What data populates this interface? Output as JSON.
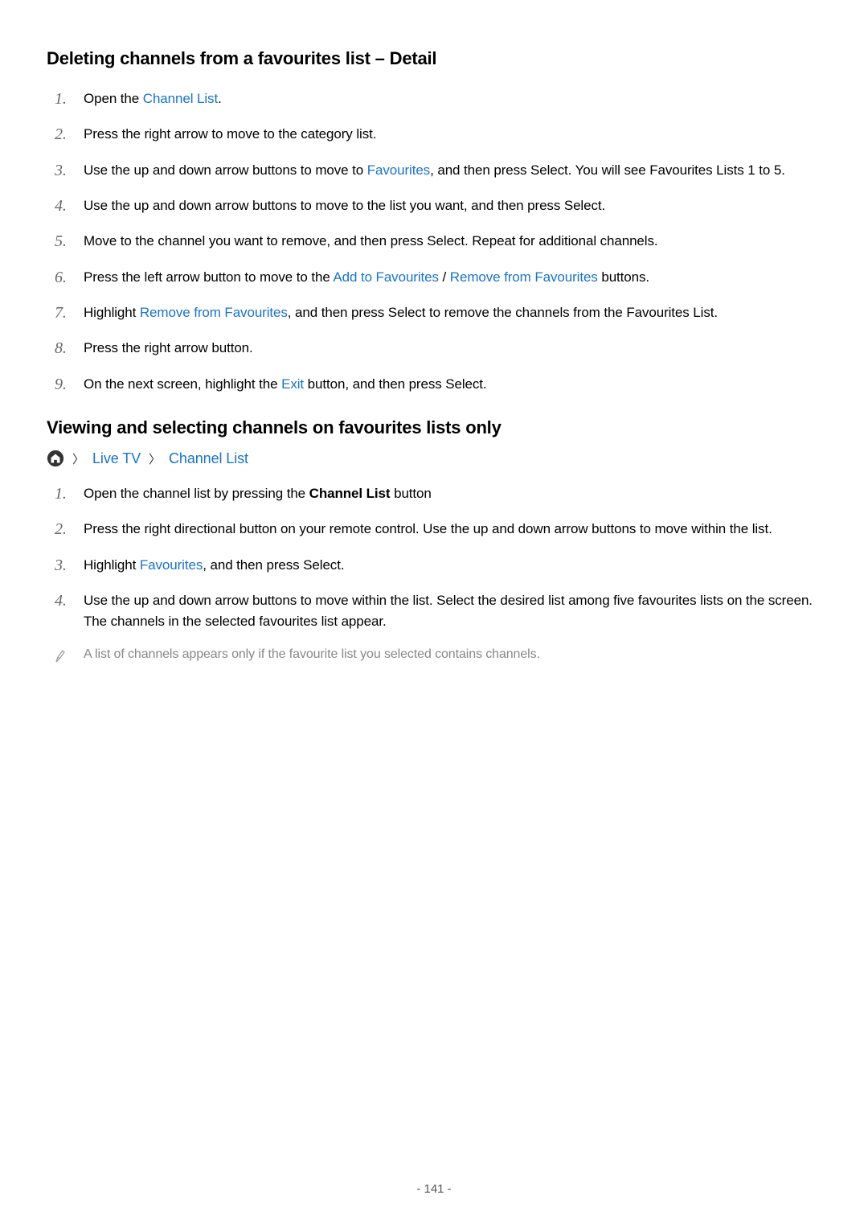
{
  "section1": {
    "heading": "Deleting channels from a favourites list – Detail",
    "steps": [
      {
        "parts": [
          {
            "text": "Open the "
          },
          {
            "text": "Channel List",
            "link": true
          },
          {
            "text": "."
          }
        ]
      },
      {
        "parts": [
          {
            "text": "Press the right arrow to move to the category list."
          }
        ]
      },
      {
        "parts": [
          {
            "text": "Use the up and down arrow buttons to move to "
          },
          {
            "text": "Favourites",
            "link": true
          },
          {
            "text": ", and then press Select. You will see Favourites Lists 1 to 5."
          }
        ]
      },
      {
        "parts": [
          {
            "text": "Use the up and down arrow buttons to move to the list you want, and then press Select."
          }
        ]
      },
      {
        "parts": [
          {
            "text": "Move to the channel you want to remove, and then press Select. Repeat for additional channels."
          }
        ]
      },
      {
        "parts": [
          {
            "text": "Press the left arrow button to move to the "
          },
          {
            "text": "Add to Favourites",
            "link": true
          },
          {
            "text": " / "
          },
          {
            "text": "Remove from Favourites",
            "link": true
          },
          {
            "text": " buttons."
          }
        ]
      },
      {
        "parts": [
          {
            "text": "Highlight "
          },
          {
            "text": "Remove from Favourites",
            "link": true
          },
          {
            "text": ", and then press Select to remove the channels from the Favourites List."
          }
        ]
      },
      {
        "parts": [
          {
            "text": "Press the right arrow button."
          }
        ]
      },
      {
        "parts": [
          {
            "text": "On the next screen, highlight the "
          },
          {
            "text": "Exit",
            "link": true
          },
          {
            "text": " button, and then press Select."
          }
        ]
      }
    ]
  },
  "section2": {
    "heading": "Viewing and selecting channels on favourites lists only",
    "breadcrumb": {
      "item1": "Live TV",
      "item2": "Channel List"
    },
    "steps": [
      {
        "parts": [
          {
            "text": "Open the channel list by pressing the "
          },
          {
            "text": "Channel List",
            "bold": true
          },
          {
            "text": " button"
          }
        ]
      },
      {
        "parts": [
          {
            "text": "Press the right directional button on your remote control. Use the up and down arrow buttons to move within the list."
          }
        ]
      },
      {
        "parts": [
          {
            "text": "Highlight "
          },
          {
            "text": "Favourites",
            "link": true
          },
          {
            "text": ", and then press Select."
          }
        ]
      },
      {
        "parts": [
          {
            "text": "Use the up and down arrow buttons to move within the list. Select the desired list among five favourites lists on the screen. The channels in the selected favourites list appear."
          }
        ]
      }
    ],
    "note": "A list of channels appears only if the favourite list you selected contains channels."
  },
  "pageNumber": "- 141 -"
}
